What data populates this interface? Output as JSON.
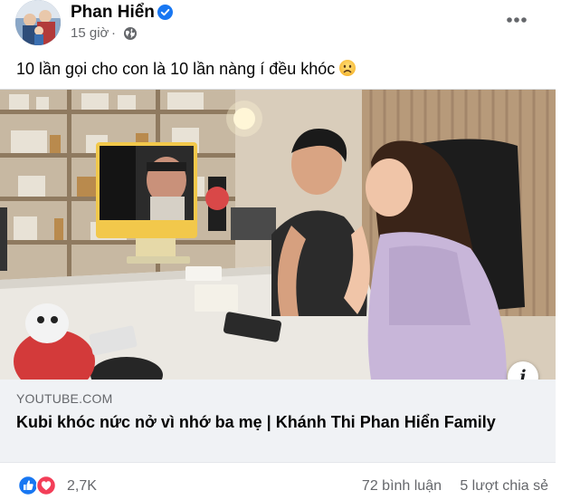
{
  "author": {
    "name": "Phan Hiển",
    "time": "15 giờ",
    "time_separator": "·",
    "audience_icon": "globe-icon",
    "verified_icon": "verified-badge-icon"
  },
  "post": {
    "caption": "10 lần gọi cho con là 10 lần nàng í đều khóc",
    "caption_emoji": "sad-face-emoji-icon"
  },
  "link_preview": {
    "domain": "YOUTUBE.COM",
    "title": "Kubi khóc nức nở vì nhớ ba mẹ | Khánh Thi Phan Hiển Family",
    "info_label": "i"
  },
  "footer": {
    "reaction_icons": [
      "like-icon",
      "love-icon"
    ],
    "reaction_count": "2,7K",
    "comments": "72 bình luận",
    "shares": "5 lượt chia sẻ"
  },
  "colors": {
    "text_primary": "#050505",
    "text_secondary": "#65676b",
    "verified_blue": "#1877f2",
    "like_blue": "#1877f2",
    "love_red": "#f33e58",
    "link_meta_bg": "#f0f2f5"
  }
}
